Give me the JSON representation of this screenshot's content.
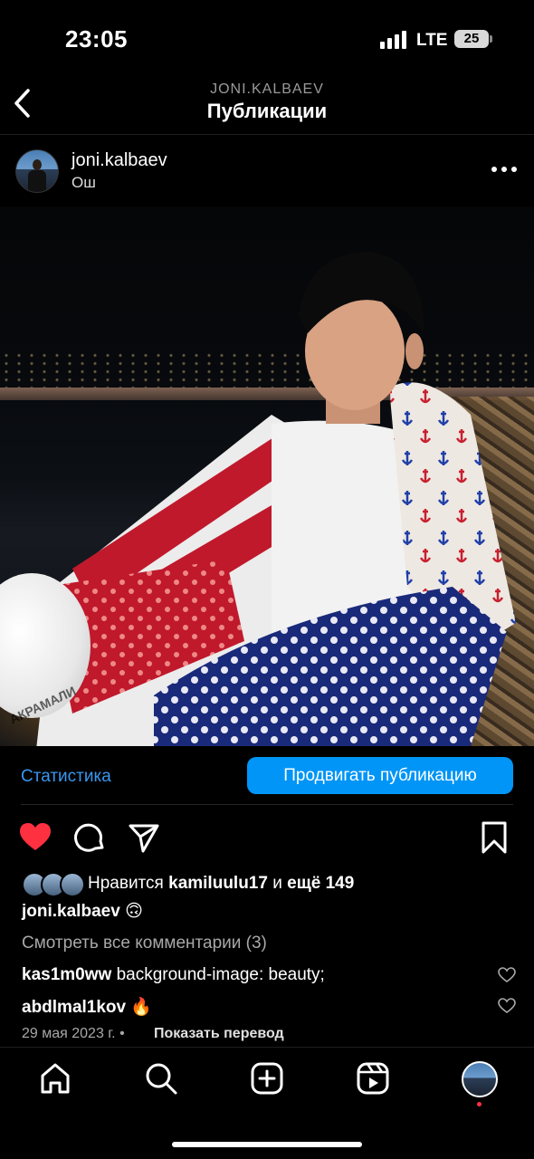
{
  "status_bar": {
    "time": "23:05",
    "network": "LTE",
    "battery": "25"
  },
  "header": {
    "username": "JONI.KALBAEV",
    "title": "Публикации"
  },
  "post": {
    "author": "joni.kalbaev",
    "location": "Ош",
    "photo_watermark": "АКРАМАЛИ",
    "stats_label": "Статистика",
    "promote_label": "Продвигать публикацию",
    "liked": true,
    "likes_prefix": "Нравится",
    "likes_user": "kamiluulu17",
    "likes_and": "и",
    "likes_more": "ещё 149",
    "caption_user": "joni.kalbaev",
    "caption_emoji": "🙃",
    "view_comments": "Смотреть все комментарии (3)",
    "comments": [
      {
        "user": "kas1m0ww",
        "text": "background-image: beauty;"
      },
      {
        "user": "abdlmal1kov",
        "text": "🔥"
      }
    ],
    "date": "29 мая 2023 г.",
    "separator": "•",
    "translate": "Показать перевод"
  },
  "colors": {
    "accent": "#0095f6",
    "link": "#3897f0",
    "like": "#ff3040",
    "background": "#000000"
  },
  "icons": {
    "back": "chevron-left-icon",
    "more": "more-horizontal-icon",
    "like": "heart-filled-icon",
    "comment": "comment-icon",
    "share": "send-icon",
    "save": "bookmark-icon",
    "nav": [
      "home-icon",
      "search-icon",
      "create-icon",
      "reels-icon",
      "profile-avatar"
    ]
  }
}
